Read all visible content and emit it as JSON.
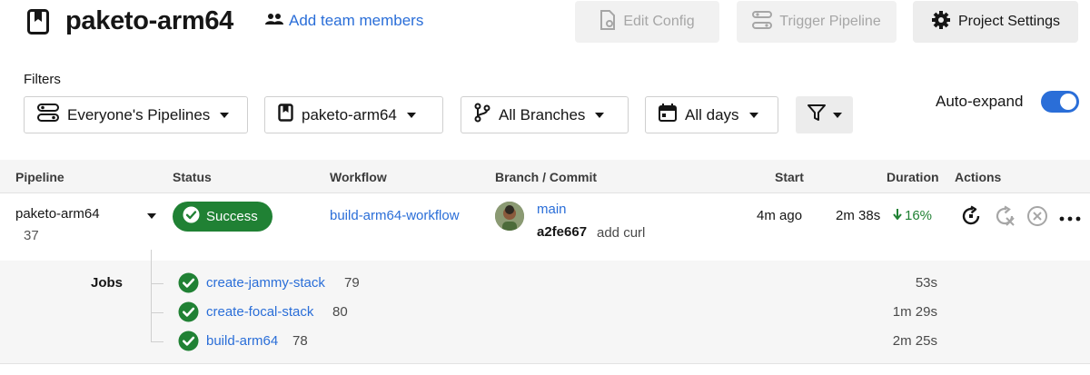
{
  "header": {
    "project_title": "paketo-arm64",
    "add_team_label": "Add team members",
    "edit_config_label": "Edit Config",
    "trigger_pipeline_label": "Trigger Pipeline",
    "project_settings_label": "Project Settings"
  },
  "filters": {
    "label": "Filters",
    "pipelines_value": "Everyone's Pipelines",
    "project_value": "paketo-arm64",
    "branches_value": "All Branches",
    "days_value": "All days",
    "auto_expand_label": "Auto-expand",
    "auto_expand_on": true
  },
  "table": {
    "columns": [
      "Pipeline",
      "Status",
      "Workflow",
      "Branch / Commit",
      "Start",
      "Duration",
      "Actions"
    ],
    "row": {
      "pipeline": "paketo-arm64",
      "number": "37",
      "status": "Success",
      "workflow": "build-arm64-workflow",
      "branch": "main",
      "commit_hash": "a2fe667",
      "commit_message": "add curl",
      "start": "4m ago",
      "duration": "2m 38s",
      "duration_change": "16%"
    },
    "jobs_label": "Jobs",
    "jobs": [
      {
        "name": "create-jammy-stack",
        "number": "79",
        "duration": "53s"
      },
      {
        "name": "create-focal-stack",
        "number": "80",
        "duration": "1m 29s"
      },
      {
        "name": "build-arm64",
        "number": "78",
        "duration": "2m 25s"
      }
    ]
  },
  "colors": {
    "link": "#2a6ed8",
    "success": "#208134",
    "toggle_on": "#2a6ed8"
  },
  "icons": {
    "project": "bookmark-icon",
    "team": "people-icon",
    "edit_config": "file-settings-icon",
    "trigger": "pipeline-icon",
    "settings": "gear-icon",
    "pipelines_filter": "pipeline-icon",
    "project_filter": "bookmark-icon",
    "branch_filter": "branch-icon",
    "days_filter": "calendar-icon",
    "more_filter": "funnel-icon"
  }
}
